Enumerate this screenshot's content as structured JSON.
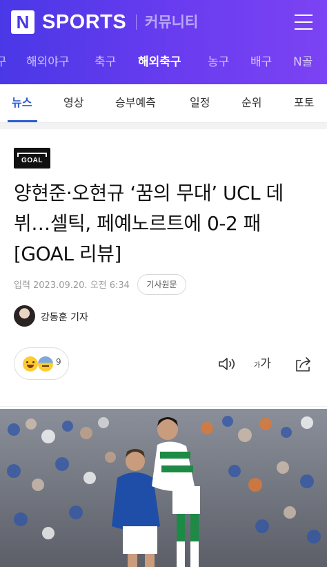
{
  "header": {
    "logo_letter": "N",
    "brand": "SPORTS",
    "community": "커뮤니티",
    "menu_icon": "hamburger-icon",
    "background_colors": [
      "#4a38e6",
      "#7b43f3"
    ]
  },
  "sport_nav": {
    "items": [
      {
        "label": "구"
      },
      {
        "label": "해외야구"
      },
      {
        "label": "축구"
      },
      {
        "label": "해외축구",
        "active": true
      },
      {
        "label": "농구"
      },
      {
        "label": "배구"
      },
      {
        "label": "N골"
      }
    ]
  },
  "tabs": {
    "items": [
      {
        "label": "뉴스",
        "active": true
      },
      {
        "label": "영상"
      },
      {
        "label": "승부예측"
      },
      {
        "label": "일정"
      },
      {
        "label": "순위"
      },
      {
        "label": "포토"
      }
    ],
    "active_color": "#2d5bd6"
  },
  "article": {
    "press_logo": "GOAL",
    "title_lines": [
      "양현준·오현규 ‘꿈의 무대’ UCL 데",
      "뷔…셀틱, 페예노르트에 0-2 패",
      "[GOAL 리뷰]"
    ],
    "meta_label": "입력",
    "date": "2023.09.20. 오전 6:34",
    "original_button": "기사원문",
    "reporter": "강동훈 기자",
    "reaction_count": "9",
    "actions": {
      "speaker": "speaker-icon",
      "font_small": "가",
      "font_big": "가",
      "share": "share-icon"
    }
  }
}
